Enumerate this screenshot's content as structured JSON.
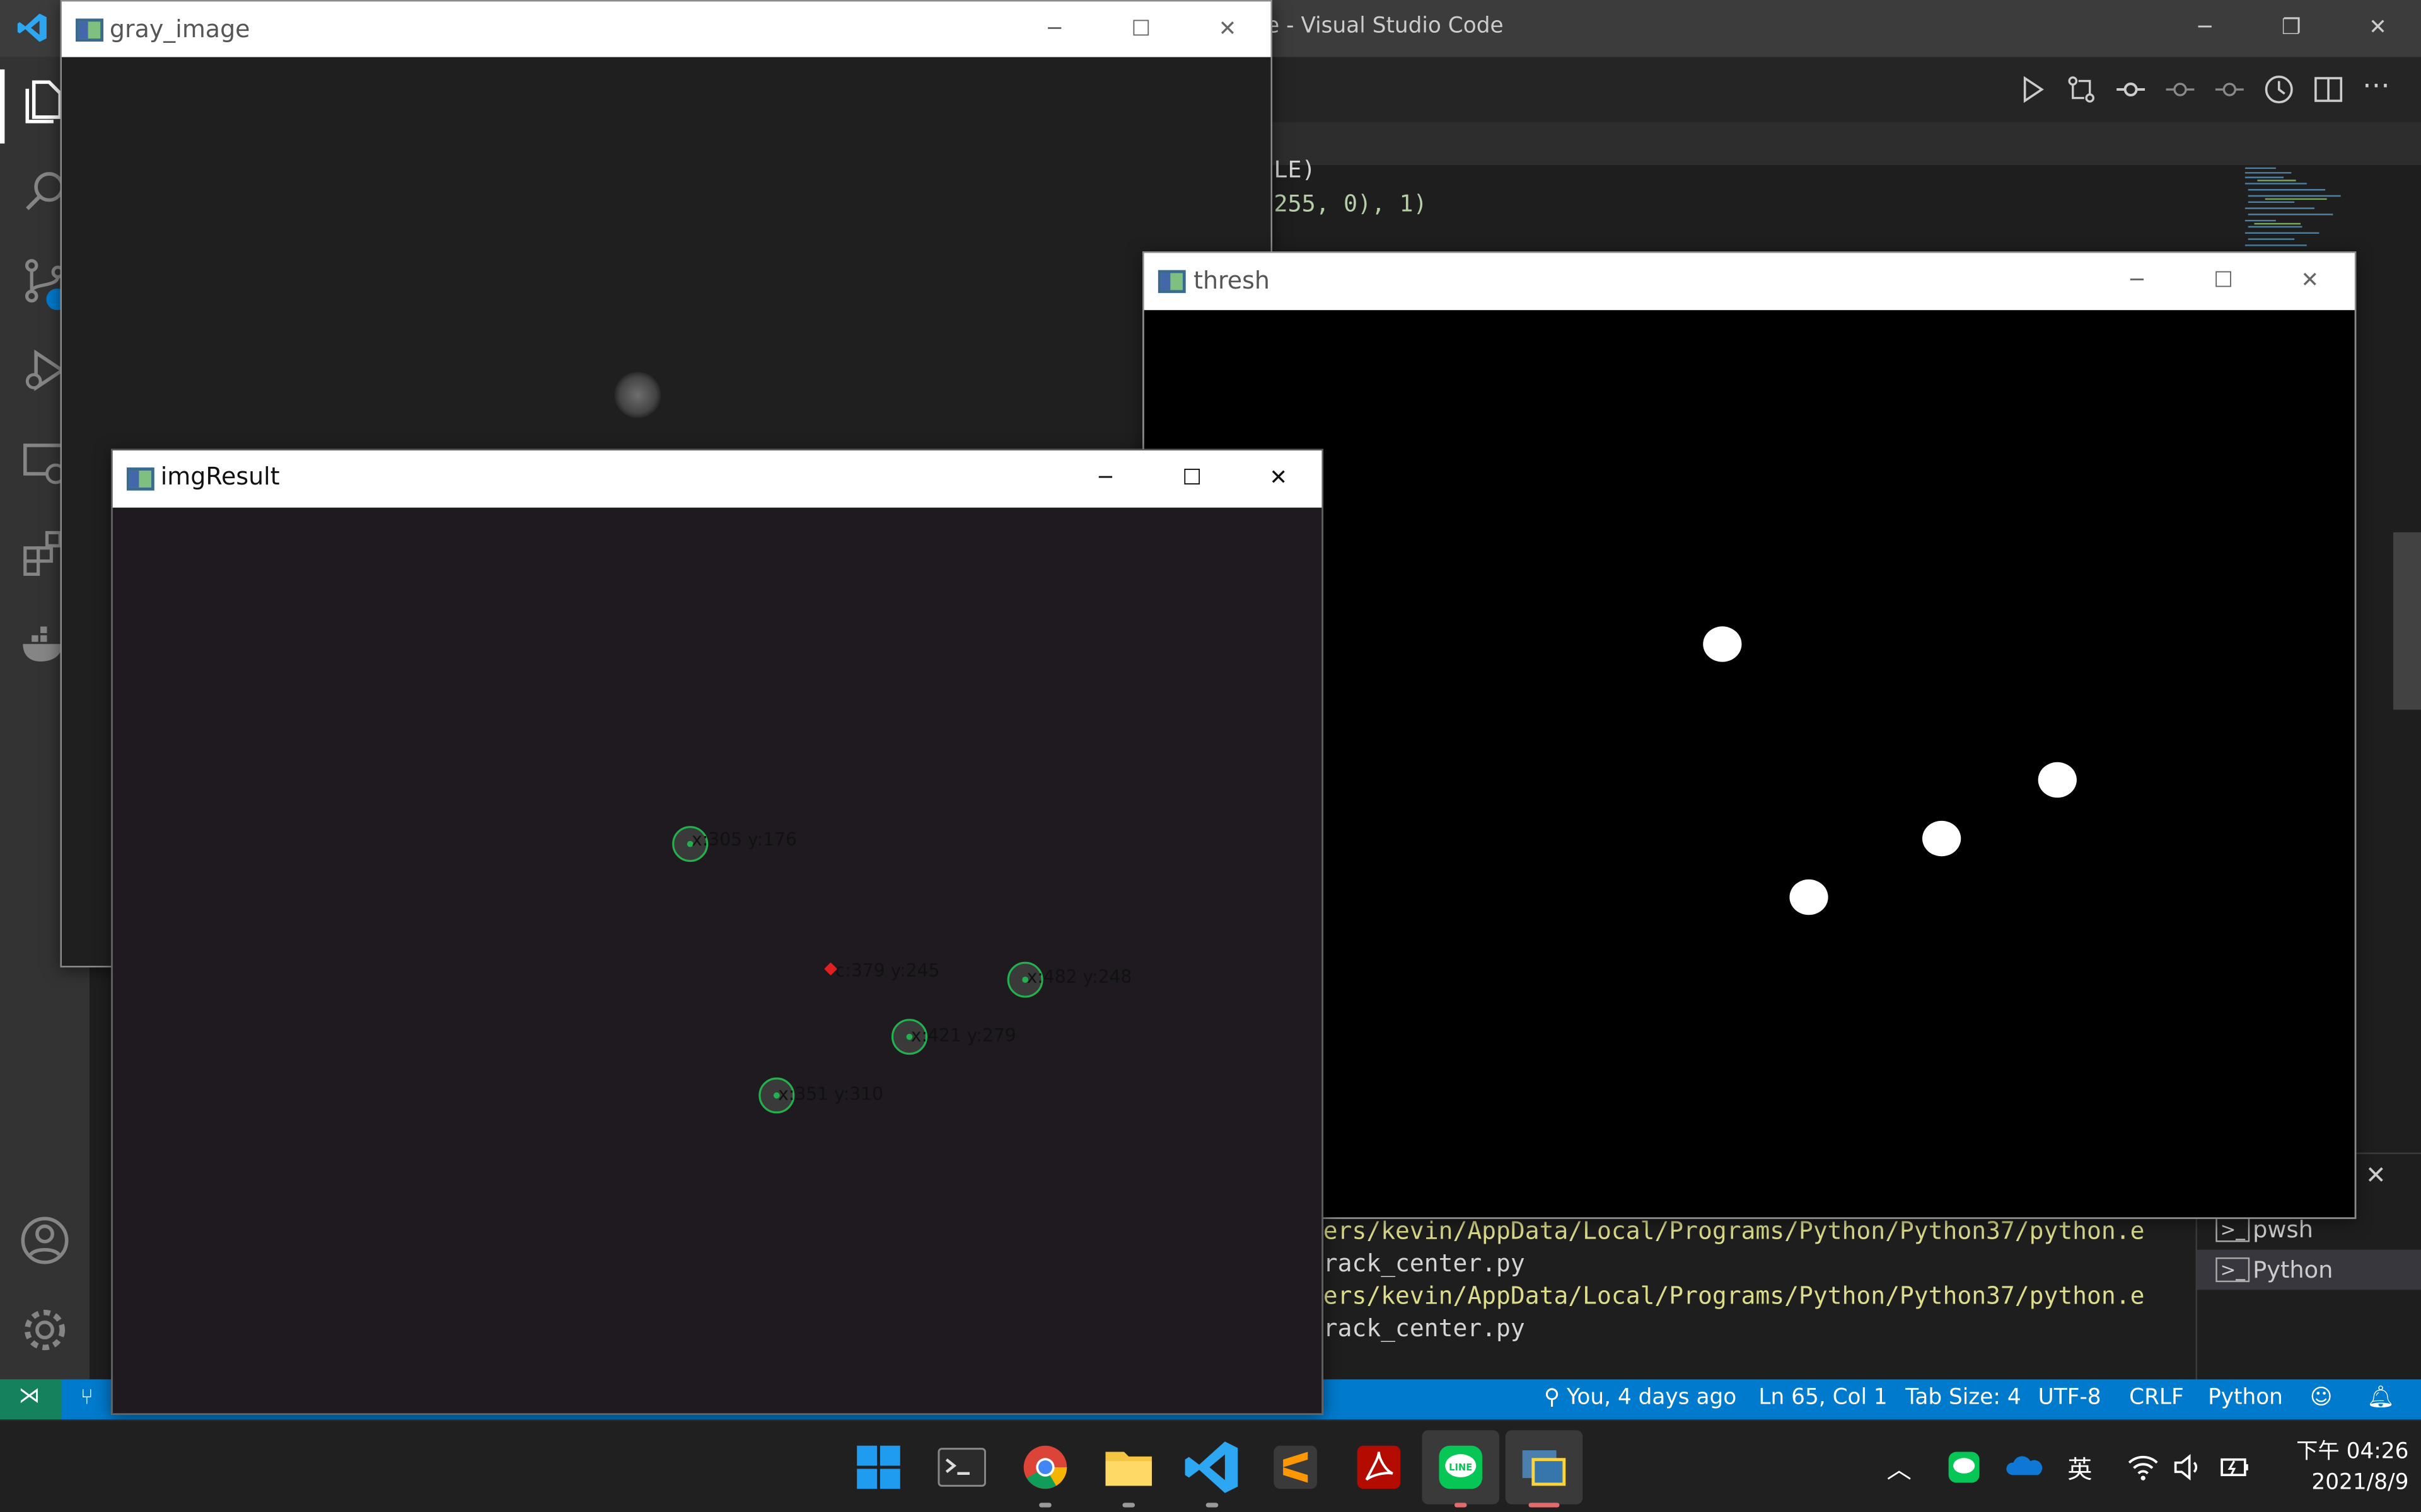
{
  "vscode": {
    "title": "e - Visual Studio Code",
    "code": [
      "LE)",
      "255, 0), 1)"
    ],
    "terminal_lines": [
      {
        "text": "ers/kevin/AppData/Local/Programs/Python/Python37/python.e",
        "color": "#dcdc8b"
      },
      {
        "text": "rack_center.py",
        "color": "#d4d4d4"
      },
      {
        "text": "ers/kevin/AppData/Local/Programs/Python/Python37/python.e",
        "color": "#dcdc8b"
      },
      {
        "text": "rack_center.py",
        "color": "#d4d4d4"
      }
    ],
    "terminals": [
      "pwsh",
      "Python"
    ],
    "status": {
      "git_blame": "You, 4 days ago",
      "position": "Ln 65, Col 1",
      "tab_size": "Tab Size: 4",
      "encoding": "UTF-8",
      "eol": "CRLF",
      "language": "Python"
    },
    "accent": "#007acc"
  },
  "windows": {
    "gray_image": {
      "title": "gray_image"
    },
    "thresh": {
      "title": "thresh"
    },
    "imgResult": {
      "title": "imgResult",
      "markers": [
        {
          "label": "x:305 y:176"
        },
        {
          "label": "x:482 y:248"
        },
        {
          "label": "x:421 y:279"
        },
        {
          "label": "x:351 y:310"
        },
        {
          "label": "c:379 y:245",
          "center": true
        }
      ]
    }
  },
  "taskbar": {
    "apps": [
      "start-menu",
      "terminal",
      "chrome",
      "file-explorer",
      "vscode",
      "sublime-text",
      "acrobat",
      "line",
      "python"
    ],
    "ime": "英",
    "time": "下午 04:26",
    "date": "2021/8/9"
  }
}
